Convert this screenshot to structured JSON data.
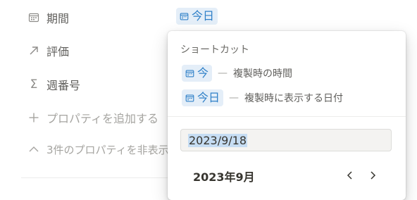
{
  "properties": [
    {
      "label": "期間",
      "icon": "calendar-icon"
    },
    {
      "label": "評価",
      "icon": "arrow-up-right-icon"
    },
    {
      "label": "週番号",
      "icon": "sigma-icon"
    }
  ],
  "period_value": "今日",
  "add_property_label": "プロパティを追加する",
  "hide_properties_label": "3件のプロパティを非表示",
  "popover": {
    "section_title": "ショートカット",
    "shortcuts": [
      {
        "chip": "今",
        "dash": "—",
        "desc": "複製時の時間"
      },
      {
        "chip": "今日",
        "dash": "—",
        "desc": "複製時に表示する日付"
      }
    ],
    "date_value": "2023/9/18",
    "month_label": "2023年9月"
  },
  "colors": {
    "chip_bg": "#e4eef8",
    "chip_text": "#2f80c8",
    "selection": "#c6ddf3"
  }
}
